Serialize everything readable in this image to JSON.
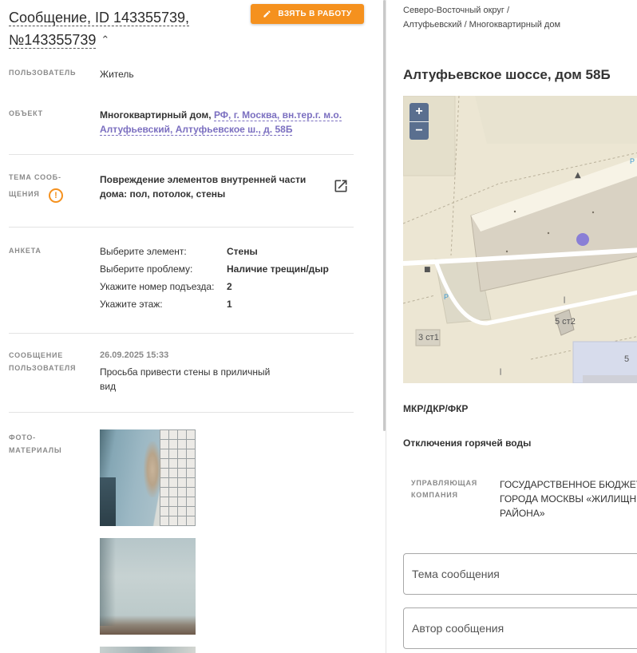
{
  "message": {
    "title_line1": "Сообщение, ID 143355739,",
    "title_line2": "№143355739",
    "take_button": "ВЗЯТЬ В РАБОТУ"
  },
  "fields": {
    "user_label": "ПОЛЬЗОВАТЕЛЬ",
    "user_value": "Житель",
    "object_label": "ОБЪЕКТ",
    "object_prefix": "Многоквартирный дом, ",
    "object_link": "РФ, г. Москва, вн.тер.г. м.о. Алтуфьевский, Алтуфьевское ш., д. 58Б",
    "topic_label_1": "ТЕМА СООБ-",
    "topic_label_2": "ЩЕНИЯ",
    "topic_value": "Повреждение элементов внутренней части дома: пол, потолок, стены",
    "survey_label": "АНКЕТА",
    "survey": [
      {
        "key": "Выберите элемент:",
        "value": "Стены"
      },
      {
        "key": "Выберите проблему:",
        "value": "Наличие трещин/дыр"
      },
      {
        "key": "Укажите номер подъезда:",
        "value": "2"
      },
      {
        "key": "Укажите этаж:",
        "value": "1"
      }
    ],
    "user_msg_label_1": "СООБЩЕНИЕ",
    "user_msg_label_2": "ПОЛЬЗОВАТЕЛЯ",
    "user_msg_date": "26.09.2025 15:33",
    "user_msg_text": "Просьба привести стены в приличный вид",
    "photos_label_1": "ФОТО-",
    "photos_label_2": "МАТЕРИАЛЫ"
  },
  "right": {
    "breadcrumb": "Северо-Восточный округ / Алтуфьевский / Многоквартирный дом",
    "address_title": "Алтуфьевское шоссе, дом 58Б",
    "map": {
      "zoom_in": "+",
      "zoom_out": "−",
      "label_building_a": "5 ст2",
      "label_building_b": "3 ст1",
      "label_building_c": "5",
      "parking": "P"
    },
    "section1": "МКР/ДКР/ФКР",
    "section2": "Отключения горячей воды",
    "manager_label_1": "УПРАВЛЯЮЩАЯ",
    "manager_label_2": "КОМПАНИЯ",
    "manager_line1": "ГОСУДАРСТВЕННОЕ БЮДЖЕТ",
    "manager_line2": "ГОРОДА МОСКВЫ «ЖИЛИЩН",
    "manager_line3": "РАЙОНА»",
    "input_topic_placeholder": "Тема сообщения",
    "input_author_placeholder": "Автор сообщения"
  },
  "colors": {
    "accent_orange": "#f5911e",
    "link_purple": "#7b6fc0",
    "map_marker": "#8a7fd6"
  }
}
